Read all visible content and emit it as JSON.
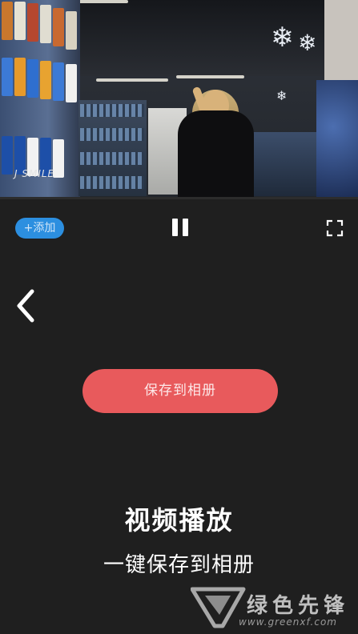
{
  "video": {
    "shelf_text": "J SMILE",
    "progress_fraction": 0.0
  },
  "controls": {
    "add_label": "+添加",
    "pause_icon": "pause-icon",
    "fullscreen_icon": "fullscreen-icon",
    "back_icon": "chevron-left-icon"
  },
  "actions": {
    "save_label": "保存到相册"
  },
  "promo": {
    "title": "视频播放",
    "subtitle": "一键保存到相册"
  },
  "watermark": {
    "name": "绿色先锋",
    "url": "www.greenxf.com"
  },
  "colors": {
    "background": "#1f1f1f",
    "add_button": "#2c8fe0",
    "save_button": "#e85a5c",
    "progress": "#3ab7a8"
  }
}
